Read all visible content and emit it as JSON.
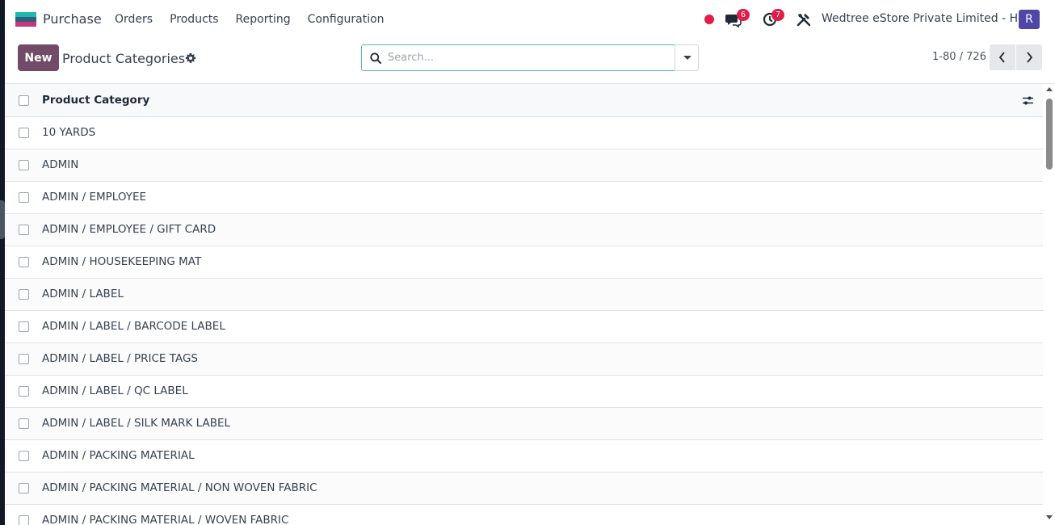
{
  "colors": {
    "brand": "#714b67",
    "badge": "#e11d48",
    "avatar": "#4f46a5",
    "search_border": "#5fb3a9"
  },
  "navbar": {
    "app_name": "Purchase",
    "menu": [
      "Orders",
      "Products",
      "Reporting",
      "Configuration"
    ],
    "messages_count": "6",
    "activities_count": "7",
    "company": "Wedtree eStore Private Limited - HO",
    "avatar_letter": "R"
  },
  "control": {
    "new_label": "New",
    "title": "Product Categories",
    "search_placeholder": "Search...",
    "pager_value": "1-80 / 726"
  },
  "list": {
    "column_header": "Product Category",
    "rows": [
      "10 YARDS",
      "ADMIN",
      "ADMIN / EMPLOYEE",
      "ADMIN / EMPLOYEE / GIFT CARD",
      "ADMIN / HOUSEKEEPING MAT",
      "ADMIN / LABEL",
      "ADMIN / LABEL / BARCODE LABEL",
      "ADMIN / LABEL / PRICE TAGS",
      "ADMIN / LABEL / QC LABEL",
      "ADMIN / LABEL / SILK MARK LABEL",
      "ADMIN / PACKING MATERIAL",
      "ADMIN / PACKING MATERIAL / NON WOVEN FABRIC",
      "ADMIN / PACKING MATERIAL / WOVEN FABRIC"
    ]
  }
}
